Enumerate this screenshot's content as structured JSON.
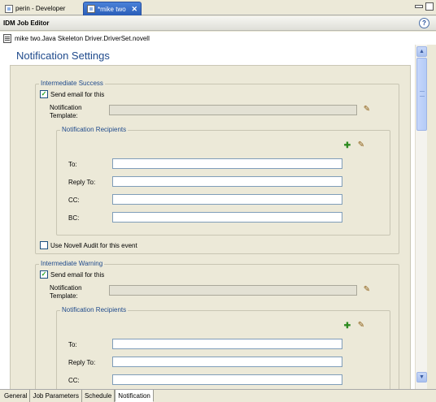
{
  "tabs": [
    {
      "label": "perin - Developer",
      "active": false
    },
    {
      "label": "*mike two",
      "active": true,
      "close": "✕"
    }
  ],
  "editor": {
    "title": "IDM Job Editor",
    "help": "?",
    "driver_path": "mike two.Java Skeleton Driver.DriverSet.novell"
  },
  "page_title": "Notification Settings",
  "sections": [
    {
      "legend": "Intermediate Success",
      "send_email_label": "Send email for this",
      "send_email_checked": true,
      "template_label_line1": "Notification",
      "template_label_line2": "Template:",
      "template_value": "",
      "recipients_legend": "Notification Recipients",
      "to_label": "To:",
      "reply_to_label": "Reply To:",
      "cc_label": "CC:",
      "bc_label": "BC:",
      "to_value": "",
      "reply_to_value": "",
      "cc_value": "",
      "bc_value": "",
      "audit_label": "Use Novell Audit for this event",
      "audit_checked": false
    },
    {
      "legend": "Intermediate Warning",
      "send_email_label": "Send email for this",
      "send_email_checked": true,
      "template_label_line1": "Notification",
      "template_label_line2": "Template:",
      "template_value": "",
      "recipients_legend": "Notification Recipients",
      "to_label": "To:",
      "reply_to_label": "Reply To:",
      "cc_label": "CC:",
      "to_value": "",
      "reply_to_value": "",
      "cc_value": ""
    }
  ],
  "bottom_tabs": [
    {
      "label": "General",
      "active": false
    },
    {
      "label": "Job Parameters",
      "active": false
    },
    {
      "label": "Schedule",
      "active": false
    },
    {
      "label": "Notification",
      "active": true
    }
  ],
  "icons": {
    "check": "✓",
    "plus": "✚",
    "edit": "✎",
    "scroll_up": "▲",
    "scroll_down": "▼"
  },
  "colors": {
    "title_blue": "#1f4a8c",
    "active_tab": "#2a5db8"
  }
}
